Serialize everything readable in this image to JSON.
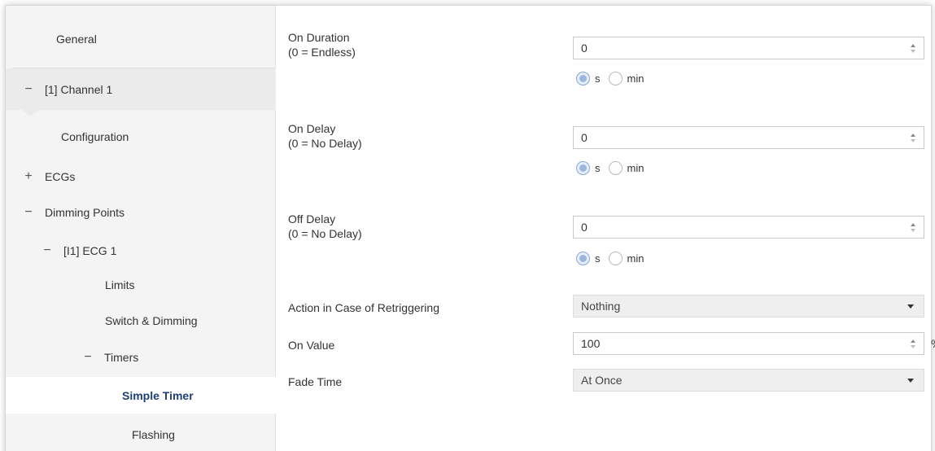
{
  "sidebar": {
    "general": "General",
    "channel": "[1] Channel 1",
    "configuration": "Configuration",
    "ecgs": "ECGs",
    "dimming_points": "Dimming Points",
    "ecg1": "[I1] ECG 1",
    "limits": "Limits",
    "switch_dimming": "Switch & Dimming",
    "timers": "Timers",
    "simple_timer": "Simple Timer",
    "flashing": "Flashing",
    "collapse_glyph": "−",
    "expand_glyph": "+"
  },
  "params": {
    "on_duration": {
      "label": "On Duration",
      "hint": "(0 = Endless)",
      "value": "0"
    },
    "on_delay": {
      "label": "On Delay",
      "hint": "(0 = No Delay)",
      "value": "0"
    },
    "off_delay": {
      "label": "Off Delay",
      "hint": "(0 = No Delay)",
      "value": "0"
    },
    "retriggering": {
      "label": "Action in Case of Retriggering",
      "value": "Nothing"
    },
    "on_value": {
      "label": "On Value",
      "value": "100",
      "unit": "%"
    },
    "fade_time": {
      "label": "Fade Time",
      "value": "At Once"
    }
  },
  "units": {
    "seconds": "s",
    "minutes": "min",
    "selected": "s"
  },
  "colors": {
    "selected_text": "#1f3f73",
    "sidebar_bg": "#f4f4f4",
    "radio_checked": "#9fb6dc"
  },
  "icons": {
    "spinner": "spin-arrows-icon",
    "dropdown": "chevron-down-icon",
    "radio": "radio-icon"
  }
}
